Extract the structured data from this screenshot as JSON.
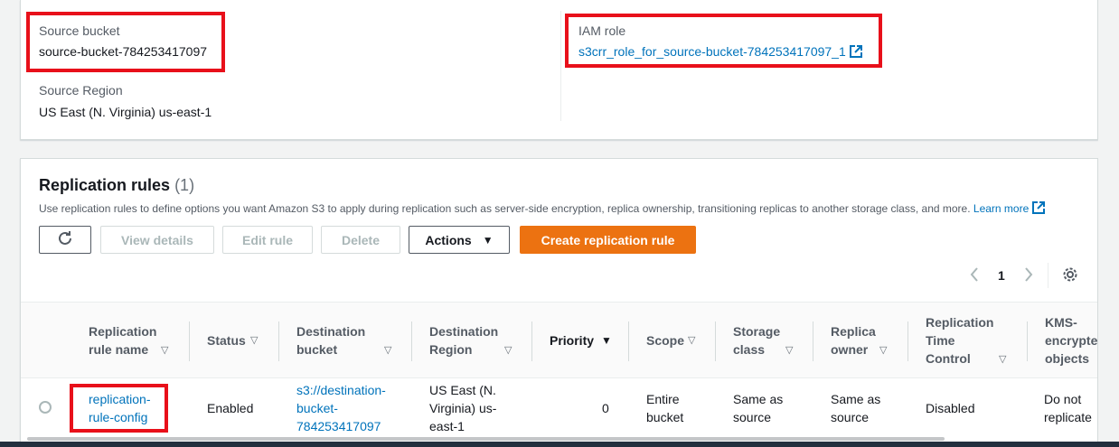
{
  "source": {
    "bucket_label": "Source bucket",
    "bucket_value": "source-bucket-784253417097",
    "region_label": "Source Region",
    "region_value": "US East (N. Virginia) us-east-1",
    "iam_label": "IAM role",
    "iam_value": "s3crr_role_for_source-bucket-784253417097_1"
  },
  "rules": {
    "title": "Replication rules",
    "count": "(1)",
    "description": "Use replication rules to define options you want Amazon S3 to apply during replication such as server-side encryption, replica ownership, transitioning replicas to another storage class, and more.",
    "learn_more": "Learn more",
    "buttons": {
      "refresh_icon": "refresh-icon",
      "view_details": "View details",
      "edit_rule": "Edit rule",
      "delete": "Delete",
      "actions": "Actions",
      "create": "Create replication rule"
    },
    "pagination": {
      "page": "1"
    },
    "columns": {
      "rule_name": [
        "Replication",
        "rule name"
      ],
      "status": "Status",
      "dest_bucket": [
        "Destination",
        "bucket"
      ],
      "dest_region": [
        "Destination",
        "Region"
      ],
      "priority": "Priority",
      "scope": "Scope",
      "storage_class": [
        "Storage",
        "class"
      ],
      "replica_owner": [
        "Replica",
        "owner"
      ],
      "rtc": [
        "Replication",
        "Time",
        "Control"
      ],
      "kms": [
        "KMS-",
        "encrypted",
        "objects"
      ]
    },
    "rows": [
      {
        "rule_name": [
          "replication-",
          "rule-config"
        ],
        "status": "Enabled",
        "dest_bucket": [
          "s3://destination-",
          "bucket-",
          "784253417097"
        ],
        "dest_region": [
          "US East (N.",
          "Virginia) us-",
          "east-1"
        ],
        "priority": "0",
        "scope": [
          "Entire",
          "bucket"
        ],
        "storage_class": [
          "Same as",
          "source"
        ],
        "replica_owner": [
          "Same as",
          "source"
        ],
        "rtc": "Disabled",
        "kms": [
          "Do not",
          "replicate"
        ]
      }
    ]
  },
  "colors": {
    "link": "#0073bb",
    "primary": "#ec7211",
    "highlight": "#e8101a"
  }
}
